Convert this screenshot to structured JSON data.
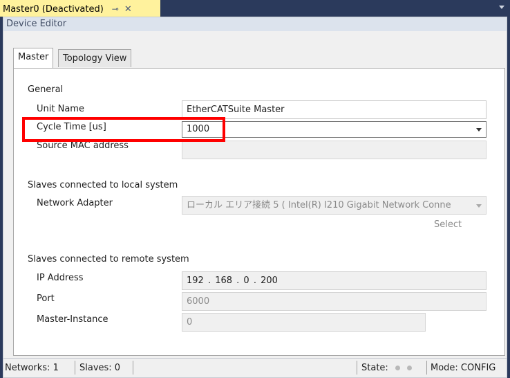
{
  "document_tab": {
    "title": "Master0 (Deactivated)",
    "pin_glyph": "⊸",
    "close_glyph": "✕"
  },
  "editor": {
    "header": "Device Editor",
    "tabs": [
      {
        "label": "Master",
        "active": true
      },
      {
        "label": "Topology View",
        "active": false
      }
    ]
  },
  "general": {
    "section_title": "General",
    "unit_name": {
      "label": "Unit Name",
      "value": "EtherCATSuite Master"
    },
    "cycle_time": {
      "label": "Cycle Time [us]",
      "value": "1000"
    },
    "source_mac": {
      "label": "Source MAC address",
      "value": ""
    }
  },
  "local": {
    "section_title": "Slaves connected to local system",
    "network_adapter": {
      "label": "Network Adapter",
      "value": "ローカル エリア接続 5 ( Intel(R) I210 Gigabit Network Conne"
    },
    "select_label": "Select"
  },
  "remote": {
    "section_title": "Slaves connected to remote system",
    "ip_address": {
      "label": "IP Address",
      "value": "192 . 168 .  0  . 200"
    },
    "port": {
      "label": "Port",
      "value": "6000"
    },
    "master_instance": {
      "label": "Master-Instance",
      "value": "0"
    }
  },
  "status": {
    "networks": "Networks: 1",
    "slaves": "Slaves: 0",
    "state_label": "State:",
    "mode": "Mode: CONFIG"
  },
  "colors": {
    "highlight": "#ff0000",
    "tab_active_bg": "#fff29d",
    "frame": "#2b3a5c"
  }
}
